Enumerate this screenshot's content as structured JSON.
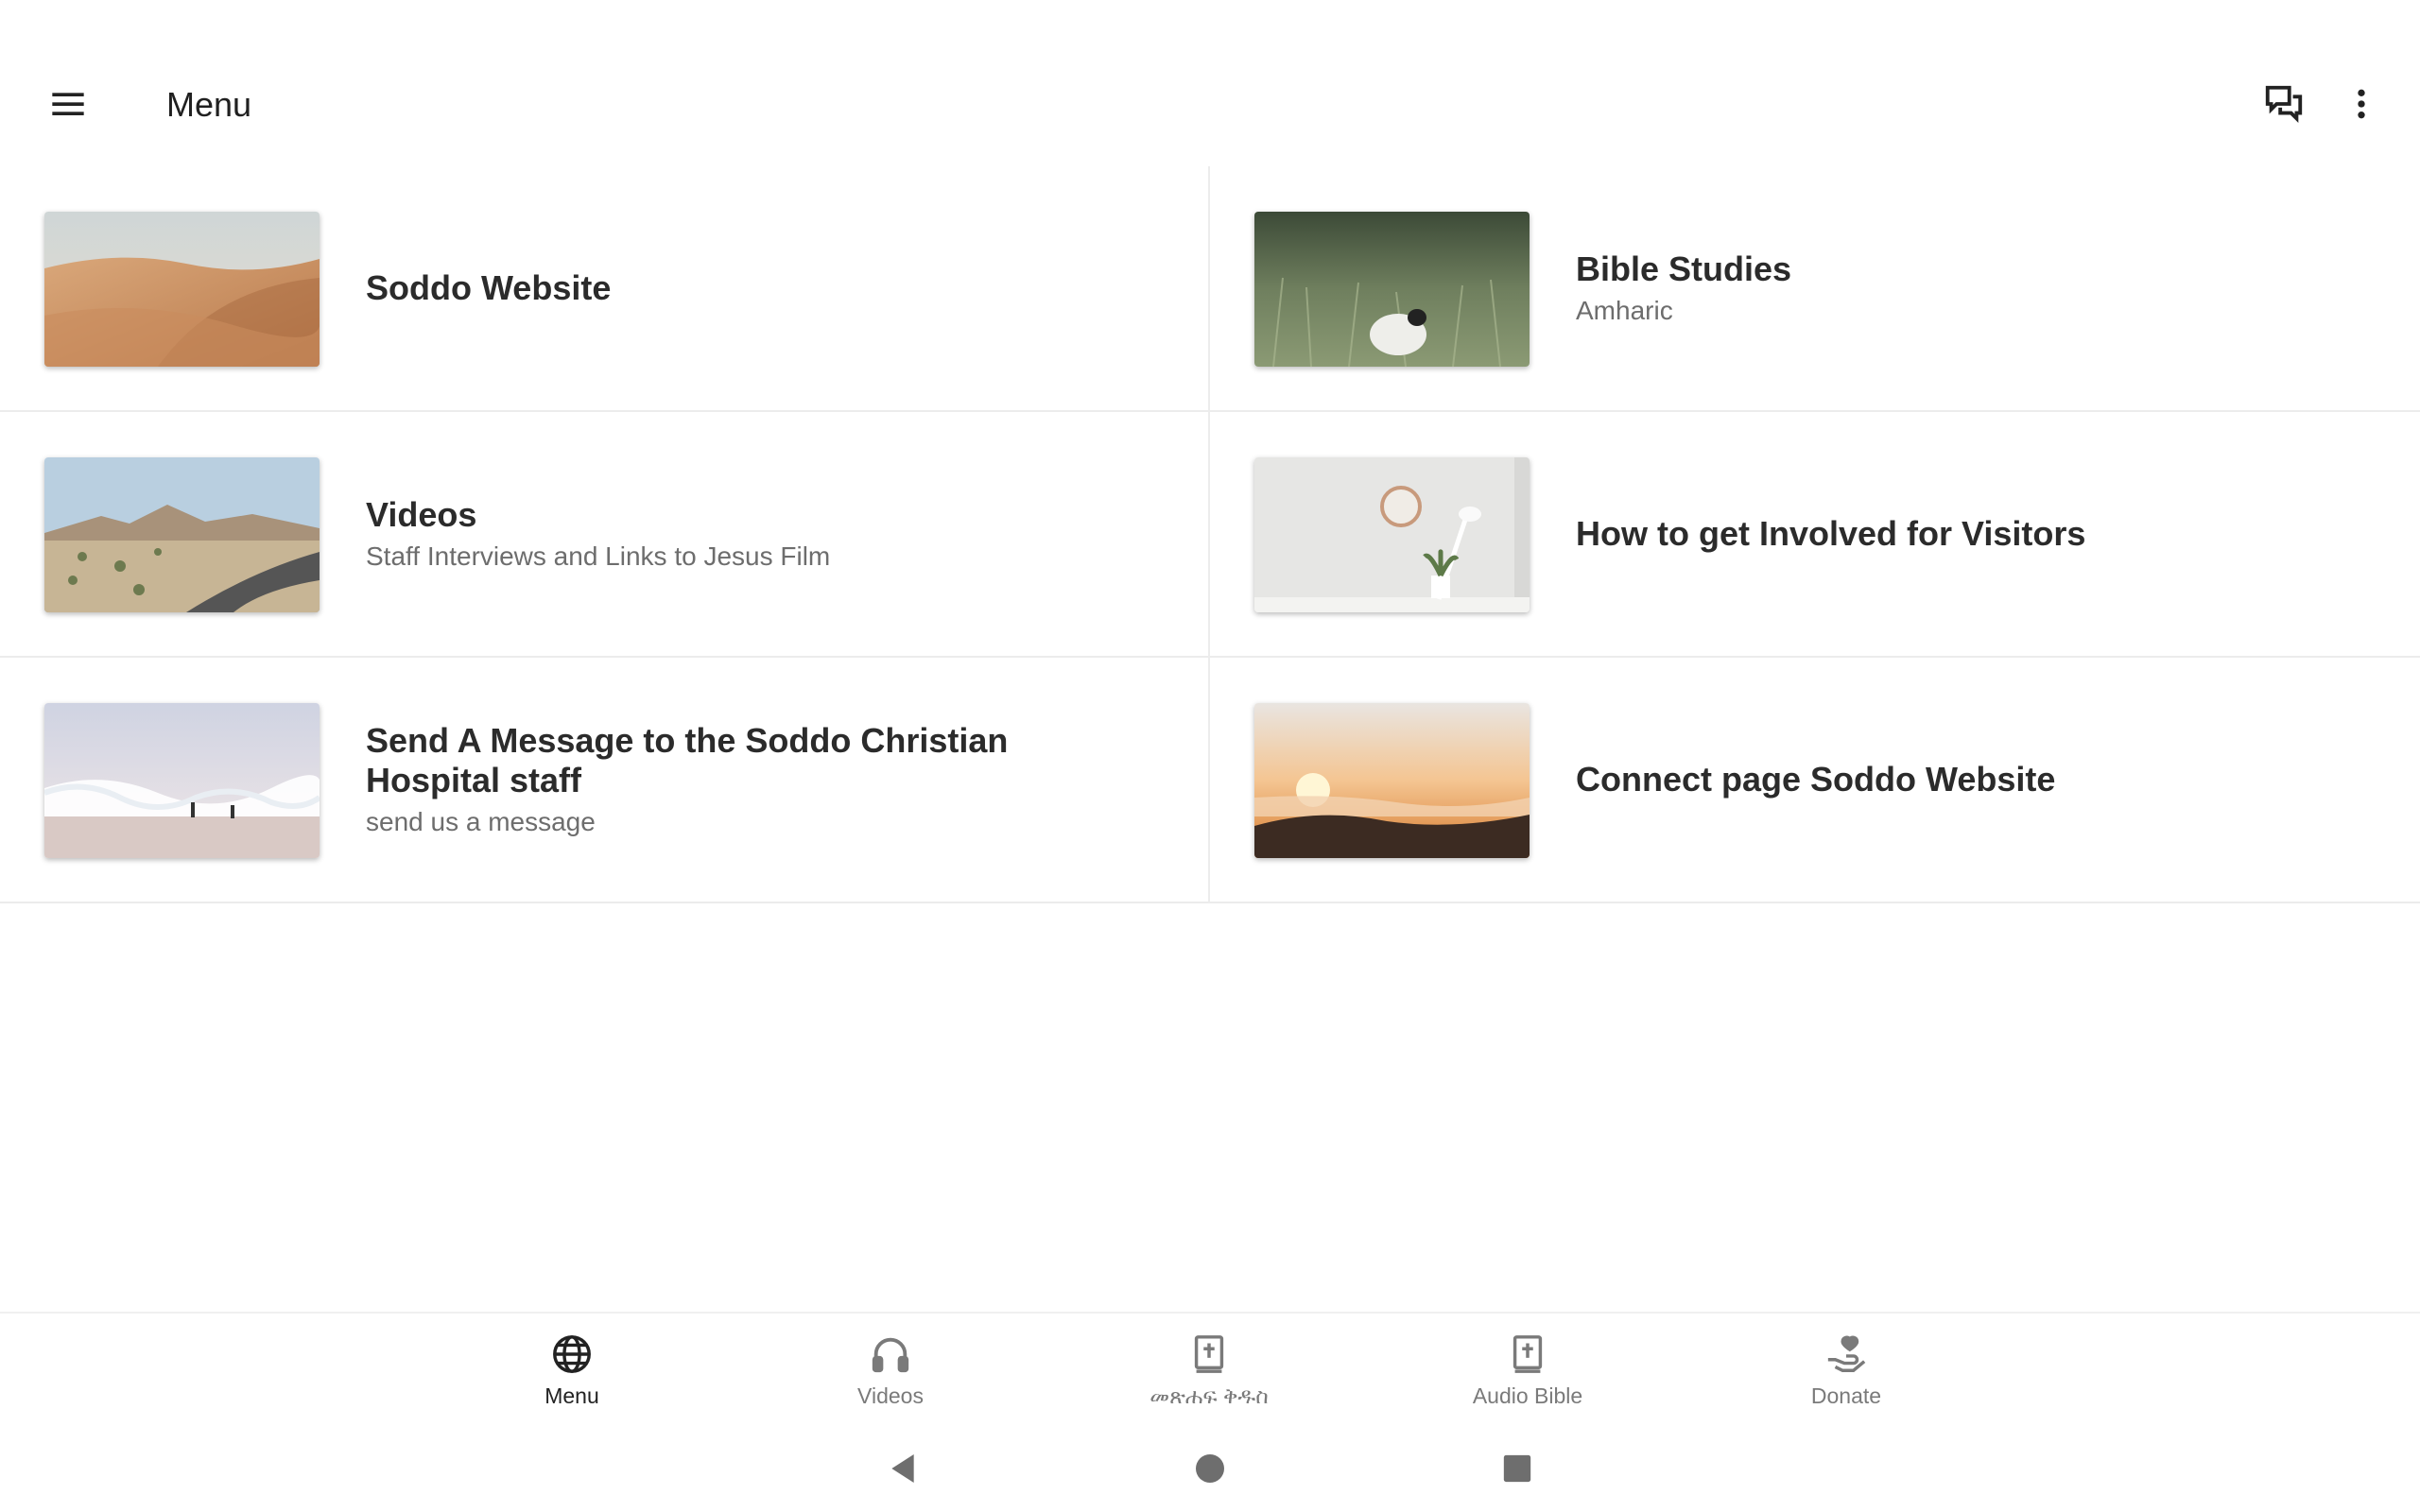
{
  "appbar": {
    "title": "Menu",
    "icons": {
      "menu": "hamburger-icon",
      "chat": "chat-icon",
      "more": "more-vert-icon"
    }
  },
  "cards": [
    {
      "title": "Soddo Website",
      "subtitle": "",
      "image": "desert-dunes"
    },
    {
      "title": "Bible Studies",
      "subtitle": "Amharic",
      "image": "lamb-in-grass"
    },
    {
      "title": "Videos",
      "subtitle": "Staff Interviews and Links to Jesus Film",
      "image": "desert-road"
    },
    {
      "title": "How to get Involved for Visitors",
      "subtitle": "",
      "image": "clock-and-plant"
    },
    {
      "title": "Send A Message to the Soddo Christian Hospital staff",
      "subtitle": "send us a message",
      "image": "beach-waves"
    },
    {
      "title": "Connect page Soddo Website",
      "subtitle": "",
      "image": "sunset-clouds"
    }
  ],
  "bottom_nav": [
    {
      "label": "Menu",
      "icon": "globe-icon",
      "active": true
    },
    {
      "label": "Videos",
      "icon": "headphones-icon",
      "active": false
    },
    {
      "label": "መጽሐፍ ቅዱስ",
      "icon": "bible-icon",
      "active": false
    },
    {
      "label": "Audio Bible",
      "icon": "bible-icon",
      "active": false
    },
    {
      "label": "Donate",
      "icon": "donate-hand-icon",
      "active": false
    }
  ],
  "colors": {
    "active": "#222222",
    "inactive": "#7a7a7a",
    "divider": "#ececec"
  }
}
